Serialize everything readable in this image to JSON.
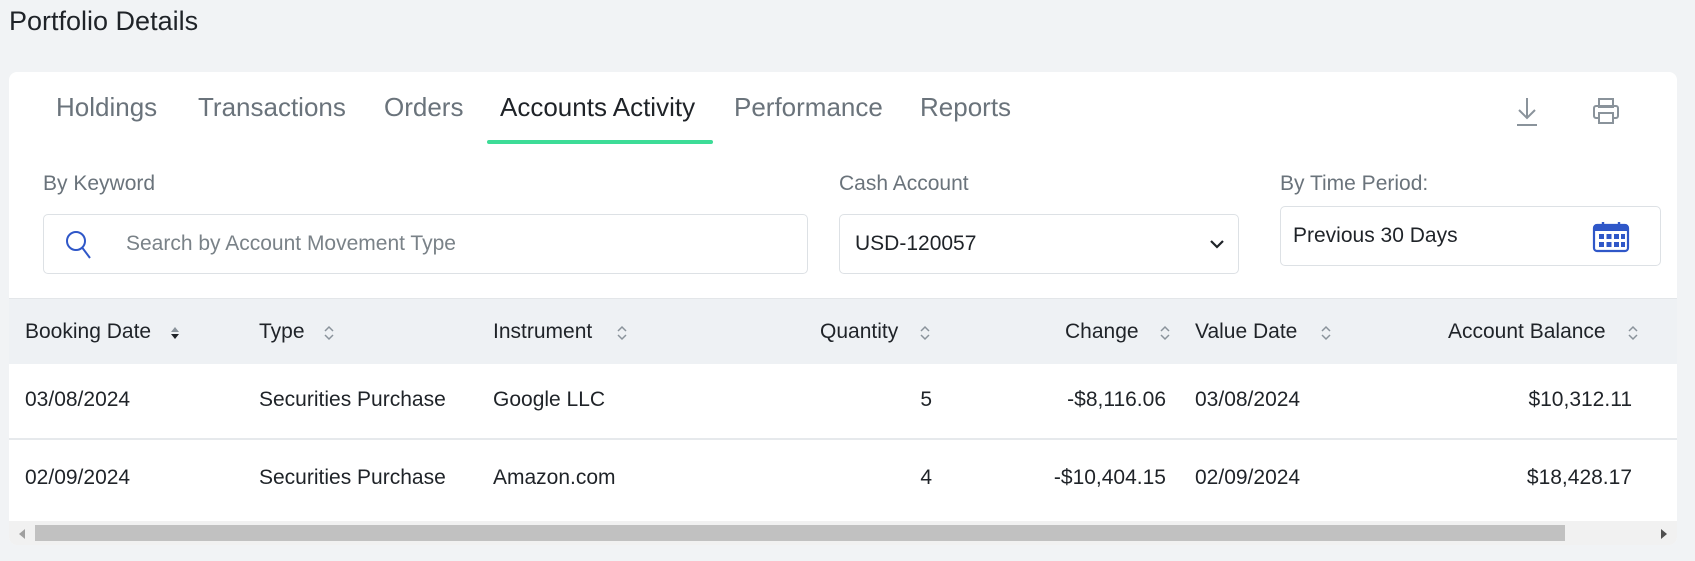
{
  "page": {
    "title": "Portfolio Details"
  },
  "tabs": [
    {
      "label": "Holdings"
    },
    {
      "label": "Transactions"
    },
    {
      "label": "Orders"
    },
    {
      "label": "Accounts Activity",
      "active": true
    },
    {
      "label": "Performance"
    },
    {
      "label": "Reports"
    }
  ],
  "toolbar": {
    "download_icon": "download-icon",
    "print_icon": "print-icon"
  },
  "filters": {
    "keyword": {
      "label": "By Keyword",
      "placeholder": "Search by Account Movement Type",
      "value": ""
    },
    "cash_account": {
      "label": "Cash Account",
      "value": "USD-120057"
    },
    "time_period": {
      "label": "By Time Period:",
      "value": "Previous 30 Days"
    }
  },
  "table": {
    "columns": [
      {
        "label": "Booking Date"
      },
      {
        "label": "Type"
      },
      {
        "label": "Instrument"
      },
      {
        "label": "Quantity"
      },
      {
        "label": "Change"
      },
      {
        "label": "Value Date"
      },
      {
        "label": "Account Balance"
      }
    ],
    "rows": [
      {
        "booking_date": "03/08/2024",
        "type": "Securities Purchase",
        "instrument": "Google LLC",
        "quantity": "5",
        "change": "-$8,116.06",
        "value_date": "03/08/2024",
        "account_balance": "$10,312.11"
      },
      {
        "booking_date": "02/09/2024",
        "type": "Securities Purchase",
        "instrument": "Amazon.com",
        "quantity": "4",
        "change": "-$10,404.15",
        "value_date": "02/09/2024",
        "account_balance": "$18,428.17"
      }
    ]
  },
  "colors": {
    "accent": "#3ddc97",
    "icon_blue": "#2f57c8",
    "header_bg": "#eef1f4"
  }
}
